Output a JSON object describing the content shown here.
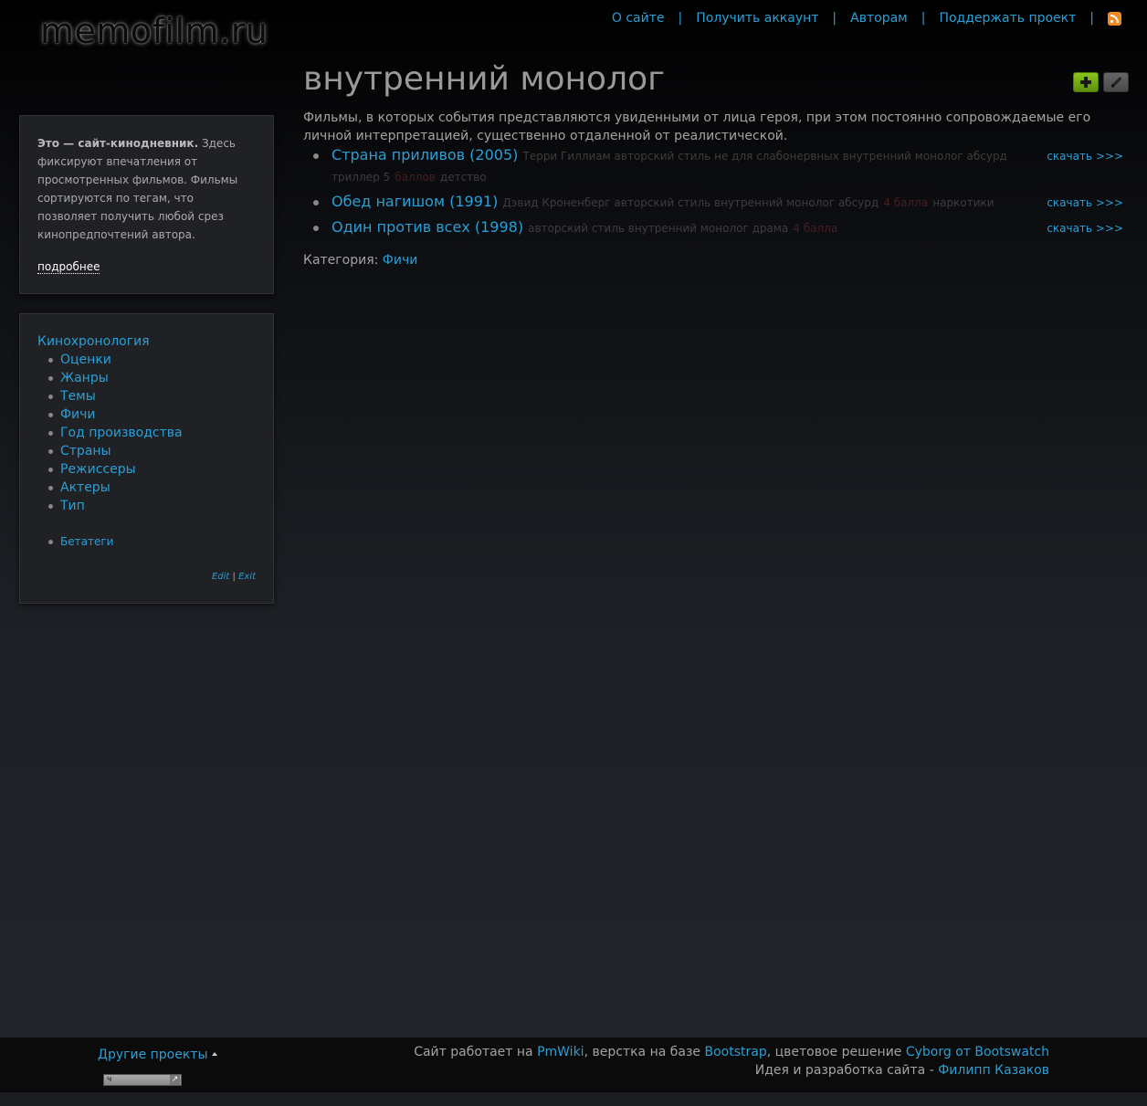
{
  "header": {
    "logo_text": "memofilm.ru",
    "nav": [
      {
        "label": "О сайте"
      },
      {
        "label": "Получить аккаунт"
      },
      {
        "label": "Авторам"
      },
      {
        "label": "Поддержать проект"
      }
    ],
    "separator": "|",
    "rss_icon": "rss-icon"
  },
  "sidebar": {
    "intro": {
      "bold": "Это — сайт-кинодневник.",
      "text": " Здесь фиксируют впечатления от просмотренных фильмов. Фильмы сортируются по тегам, что позволяет получить любой срез кинопредпочтений автора.",
      "more_link": "подробнее"
    },
    "nav": {
      "chronology": "Кинохронология",
      "items": [
        "Оценки",
        "Жанры",
        "Темы",
        "Фичи",
        "Год производства",
        "Страны",
        "Режиссеры",
        "Актеры",
        "Тип"
      ],
      "beta": "Бетатеги",
      "edit": "Edit",
      "sep": "|",
      "exit": "Exit"
    }
  },
  "main": {
    "title": "внутренний монолог",
    "add_button_icon": "plus-icon",
    "edit_button_icon": "pencil-icon",
    "description": "Фильмы, в которых события представляются увиденными от лица героя, при этом постоянно сопровождаемые его личной интерпретацией, существенно отдаленной от реалистической.",
    "films": [
      {
        "title": "Страна приливов (2005)",
        "tags_before": "Терри Гиллиам авторский стиль не для слабонервных внутренний монолог абсурд триллер 5",
        "rating": "баллов",
        "tags_after": "детство",
        "download": "скачать >>>"
      },
      {
        "title": "Обед нагишом (1991)",
        "tags_before": "Дэвид Кроненберг авторский стиль внутренний монолог абсурд",
        "rating": "4 балла",
        "tags_after": "наркотики",
        "download": "скачать >>>"
      },
      {
        "title": "Один против всех (1998)",
        "tags_before": "авторский стиль внутренний монолог драма",
        "rating": "4 балла",
        "tags_after": "",
        "download": "скачать >>>"
      }
    ],
    "category_label": "Категория:",
    "category_link": "Фичи"
  },
  "footer": {
    "other_projects": "Другие проекты",
    "counter_text": "ч",
    "credits_line1": {
      "t1": "Сайт работает на ",
      "l1": "PmWiki",
      "t2": ", верстка на базе ",
      "l2": "Bootstrap",
      "t3": ", цветовое решение ",
      "l3": "Cyborg от Bootswatch"
    },
    "credits_line2": {
      "t1": "Идея и разработка сайта - ",
      "l1": "Филипп Казаков"
    }
  },
  "colors": {
    "link": "#2a9fd6",
    "add_button": "#73a839",
    "rating": "#4a1e1e"
  }
}
